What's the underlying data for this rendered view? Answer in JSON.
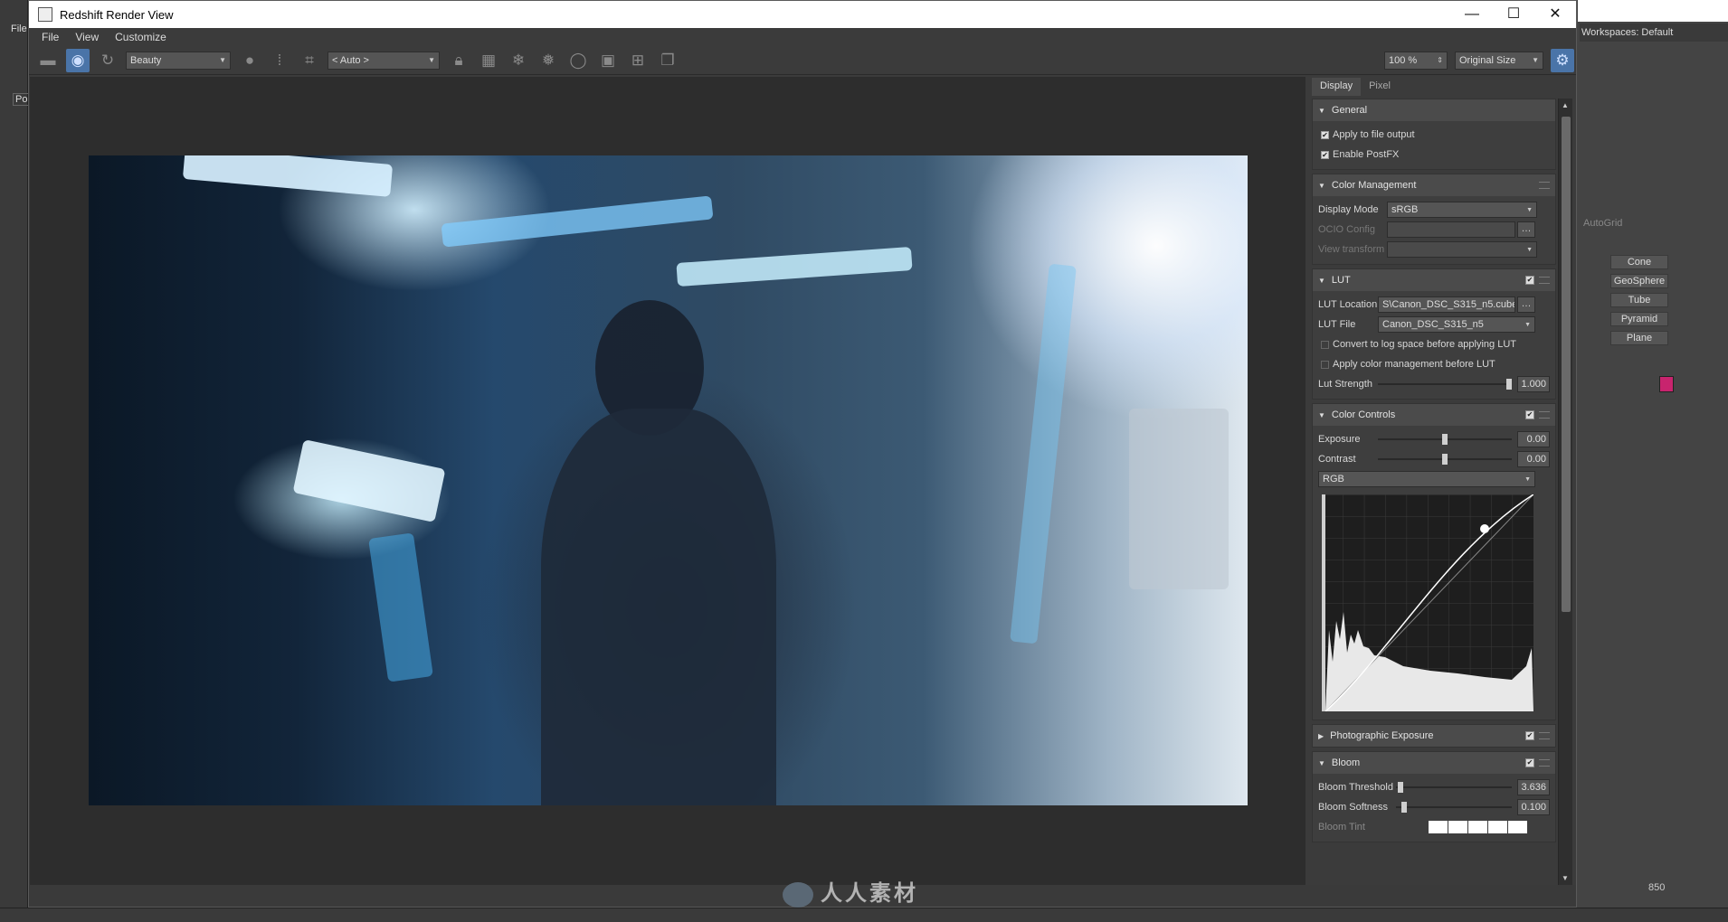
{
  "window": {
    "title": "Redshift Render View",
    "minimize": "—",
    "maximize": "☐",
    "close": "✕"
  },
  "menu": [
    "File",
    "View",
    "Customize"
  ],
  "toolbar": {
    "aov_select": "Beauty",
    "camera_select": "< Auto >",
    "zoom_select": "100 %",
    "size_select": "Original Size"
  },
  "tabs": [
    "Display",
    "Pixel"
  ],
  "sections": {
    "general": {
      "title": "General",
      "apply_to_file_output": "Apply to file output",
      "enable_postfx": "Enable PostFX"
    },
    "color_management": {
      "title": "Color Management",
      "display_mode_label": "Display Mode",
      "display_mode_value": "sRGB",
      "ocio_config_label": "OCIO Config",
      "ocio_config_value": "",
      "view_transform_label": "View transform",
      "view_transform_value": ""
    },
    "lut": {
      "title": "LUT",
      "location_label": "LUT Location",
      "location_value": "S\\Canon_DSC_S315_n5.cube",
      "file_label": "LUT File",
      "file_value": "Canon_DSC_S315_n5",
      "convert_log": "Convert to log space before applying LUT",
      "apply_cm": "Apply color management before LUT",
      "strength_label": "Lut Strength",
      "strength_value": "1.000",
      "strength_level": 1.0
    },
    "color_controls": {
      "title": "Color Controls",
      "exposure_label": "Exposure",
      "exposure_value": "0.00",
      "contrast_label": "Contrast",
      "contrast_value": "0.00",
      "channel_select": "RGB"
    },
    "photographic_exposure": {
      "title": "Photographic Exposure"
    },
    "bloom": {
      "title": "Bloom",
      "threshold_label": "Bloom Threshold",
      "threshold_value": "3.636",
      "softness_label": "Bloom Softness",
      "softness_value": "0.100",
      "tint_label": "Bloom Tint"
    }
  },
  "background_app": {
    "menu_file": "File",
    "workspaces": "Workspaces: Default",
    "autogrid": "AutoGrid",
    "buttons": [
      "Cone",
      "GeoSphere",
      "Tube",
      "Pyramid",
      "Plane"
    ],
    "swatch_color": "#c8246e",
    "timeline_value": "850",
    "left_tab": "Po"
  },
  "watermark": "人人素材"
}
